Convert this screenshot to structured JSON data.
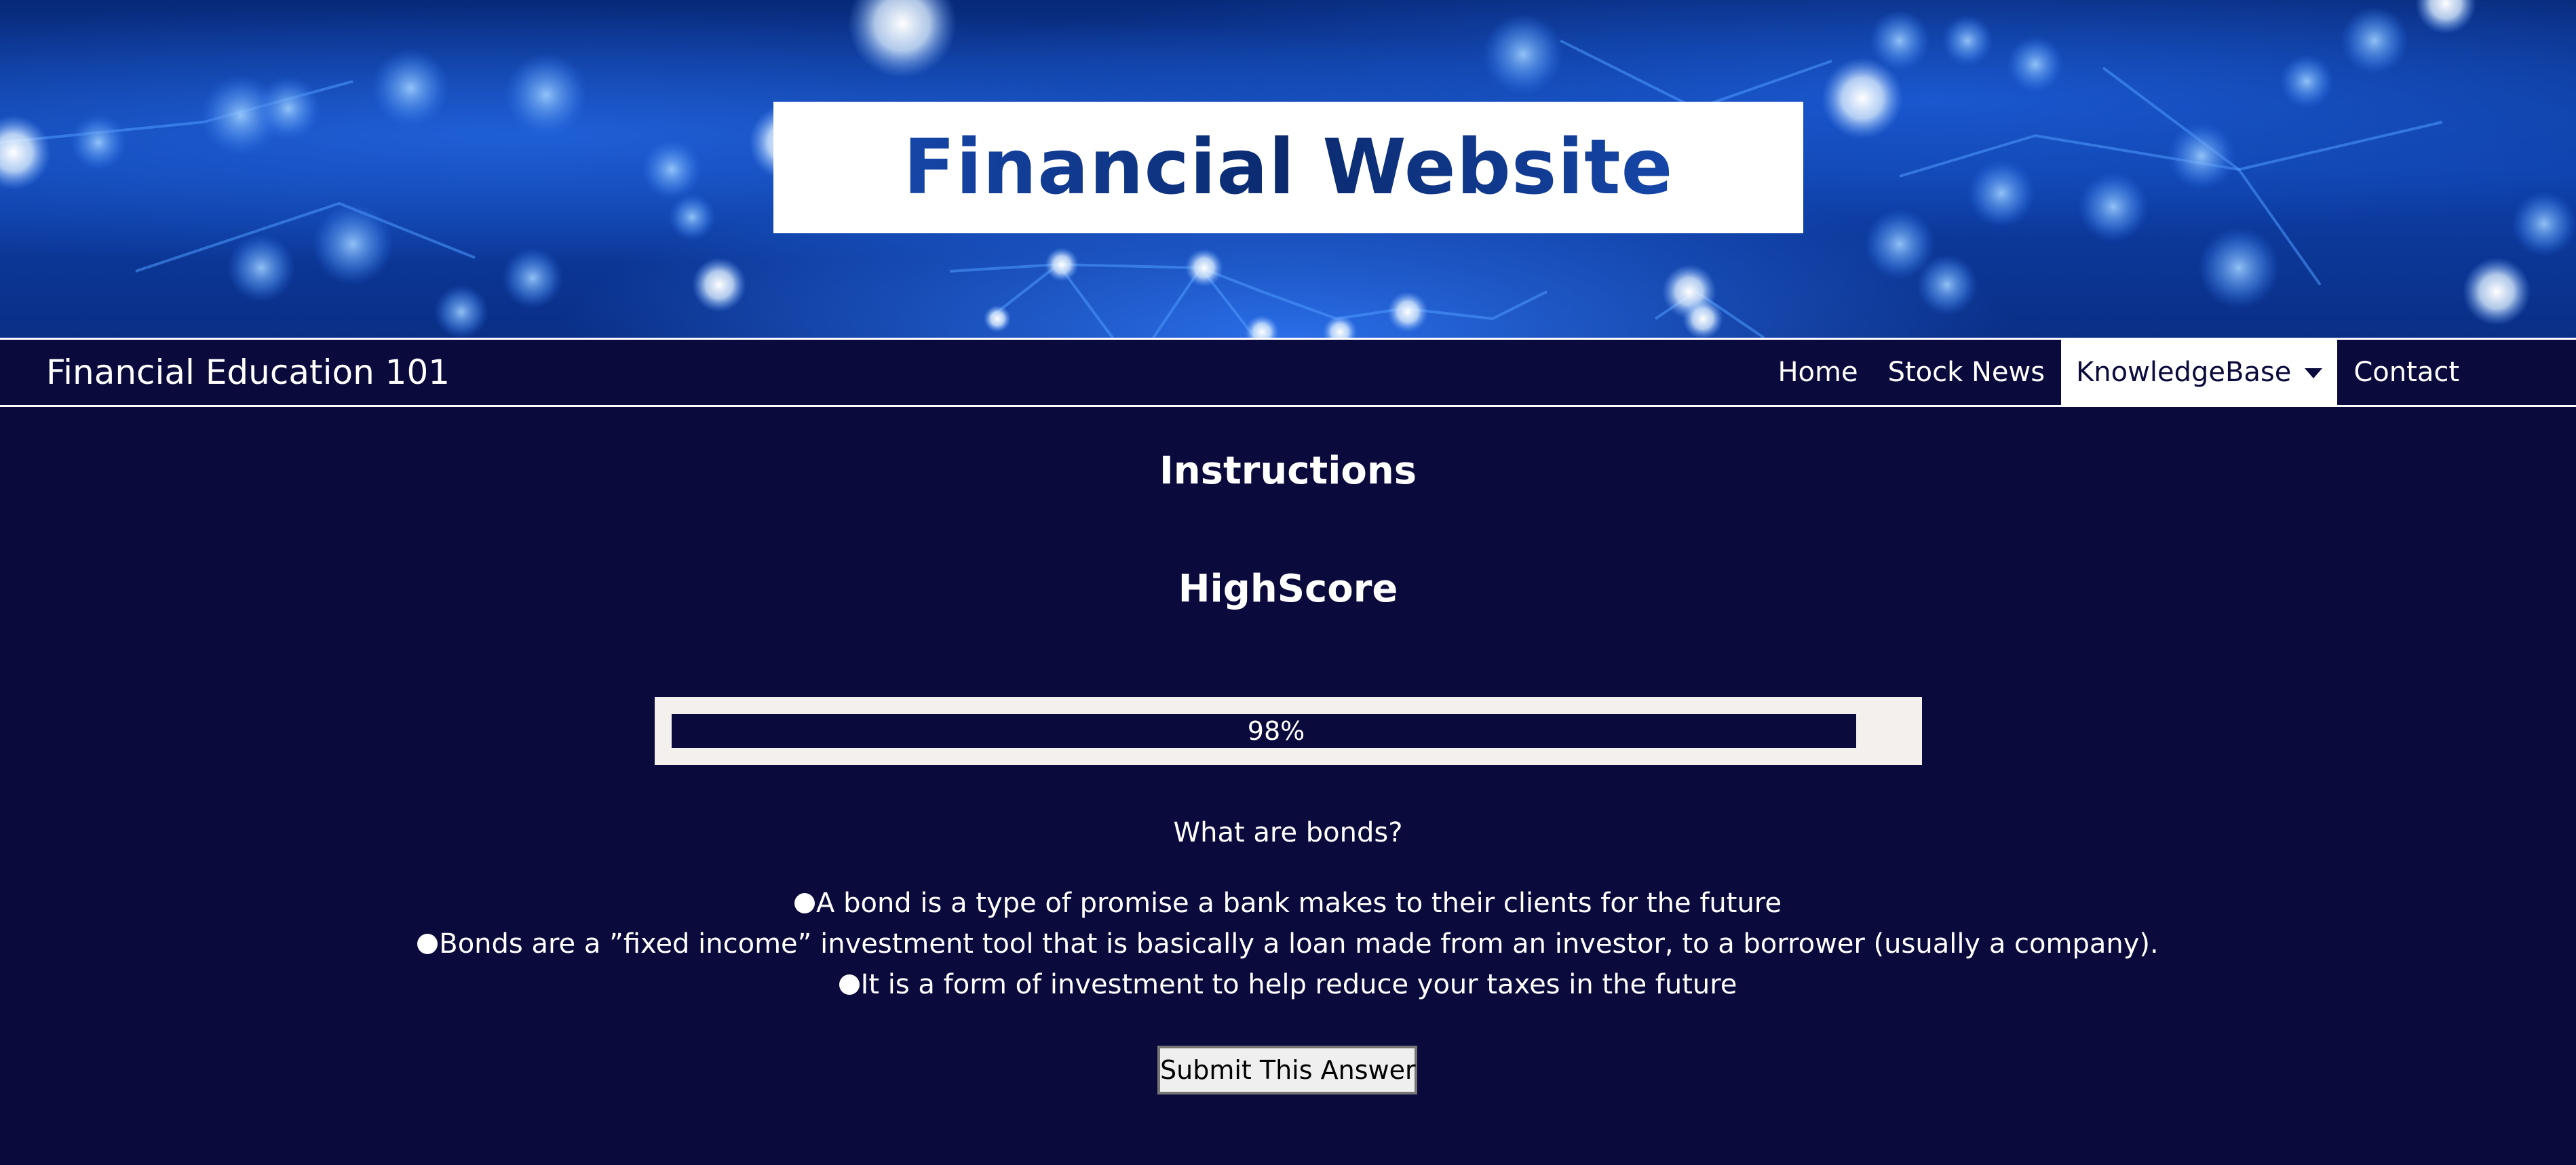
{
  "hero": {
    "site_title": "Financial Website"
  },
  "navbar": {
    "brand": "Financial Education 101",
    "links": [
      {
        "label": "Home"
      },
      {
        "label": "Stock News"
      },
      {
        "label": "KnowledgeBase",
        "active": true,
        "has_dropdown": true
      },
      {
        "label": "Contact"
      }
    ]
  },
  "main": {
    "instructions_heading": "Instructions",
    "highscore_heading": "HighScore",
    "progress": {
      "percent": 98,
      "label": "98%"
    },
    "quiz": {
      "question": "What are bonds?",
      "answers": [
        {
          "text": "A bond is a type of promise a bank makes to their clients for the future"
        },
        {
          "text": "Bonds are a ”fixed income” investment tool that is basically a loan made from an investor, to a borrower (usually a company)."
        },
        {
          "text": "It is a form of investment to help reduce your taxes in the future"
        }
      ],
      "submit_label": "Submit This Answer"
    }
  },
  "colors": {
    "page_background": "#0a0a3c",
    "hero_blue": "#0d3fa8",
    "title_text": "#0b2a6e",
    "progress_frame": "#f4f0ee"
  }
}
